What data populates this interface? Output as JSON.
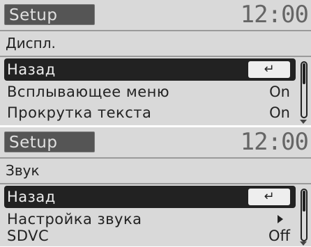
{
  "screens": [
    {
      "tab_title": "Setup",
      "clock": "12:00",
      "section": "Диспл.",
      "back_label": "Назад",
      "back_icon": "return-arrow-icon",
      "items": [
        {
          "label": "Всплывающее меню",
          "value": "On"
        },
        {
          "label": "Прокрутка текста",
          "value": "On"
        }
      ]
    },
    {
      "tab_title": "Setup",
      "clock": "12:00",
      "section": "Звук",
      "back_label": "Назад",
      "back_icon": "return-arrow-icon",
      "items": [
        {
          "label": "Настройка звука",
          "value": "",
          "icon": "chevron-right-icon"
        },
        {
          "label": "SDVC",
          "value": "Off"
        }
      ]
    }
  ],
  "colors": {
    "background": "#d9d9d9",
    "tab_bg": "#555555",
    "selected_bg": "#222222",
    "text": "#222222"
  }
}
